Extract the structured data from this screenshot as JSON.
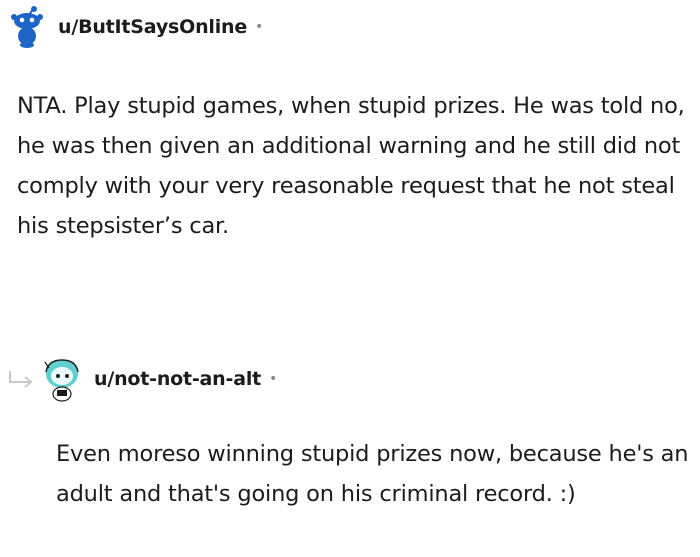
{
  "comments": [
    {
      "username": "u/ButItSaysOnline",
      "separator": "•",
      "body": "NTA. Play stupid games, when stupid prizes. He was told no, he was then given an additional warning and he still did not comply with your very reasonable request that he not steal his stepsister’s car.",
      "avatar_icon": "reddit-snoo-blue-avatar-icon"
    },
    {
      "username": "u/not-not-an-alt",
      "separator": "•",
      "body": "Even moreso winning stupid prizes now, because he's an adult and that's going on his criminal record. :)",
      "avatar_icon": "reddit-snoo-teal-avatar-icon",
      "reply_icon": "reply-arrow-icon"
    }
  ],
  "colors": {
    "text": "#1c1c1c",
    "meta": "#878a8c",
    "snoo_blue": "#1e64c8",
    "snoo_teal": "#5fd0cf"
  }
}
